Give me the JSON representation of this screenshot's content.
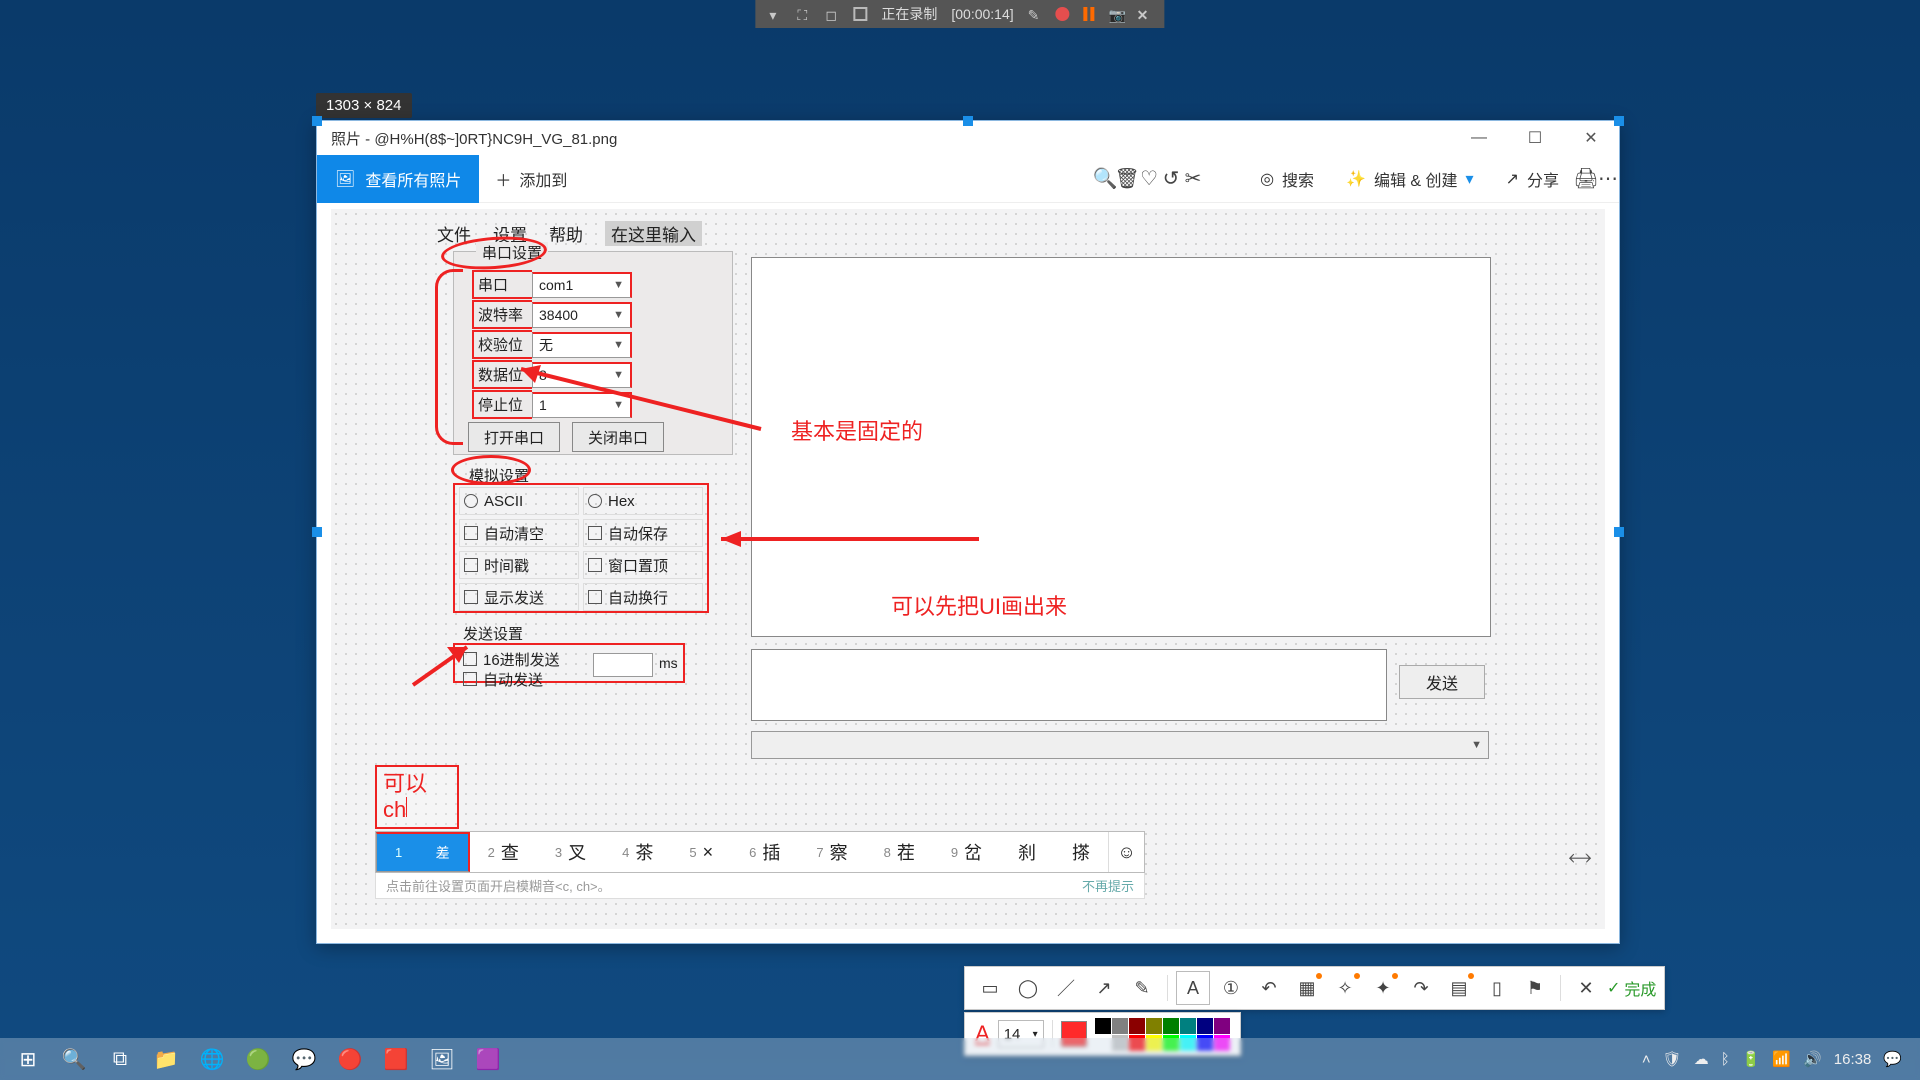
{
  "recorder": {
    "status": "正在录制",
    "time": "[00:00:14]"
  },
  "dim_badge": "1303 × 824",
  "window": {
    "title": "照片 - @H%H(8$~]0RT}NC9H_VG_81.png",
    "toolbar": {
      "view_all": "查看所有照片",
      "add_to": "添加到",
      "search": "搜索",
      "edit_create": "编辑 & 创建",
      "share": "分享"
    }
  },
  "menubar": {
    "file": "文件",
    "settings": "设置",
    "help": "帮助",
    "hint": "在这里输入"
  },
  "serial": {
    "group_title": "串口设置",
    "port_label": "串口",
    "port_value": "com1",
    "baud_label": "波特率",
    "baud_value": "38400",
    "parity_label": "校验位",
    "parity_value": "无",
    "data_label": "数据位",
    "data_value": "8",
    "stop_label": "停止位",
    "stop_value": "1",
    "open_btn": "打开串口",
    "close_btn": "关闭串口"
  },
  "recv": {
    "group_title": "模拟设置",
    "ascii": "ASCII",
    "hex": "Hex",
    "auto_clear": "自动清空",
    "auto_save": "自动保存",
    "timestamp": "时间戳",
    "topmost": "窗口置顶",
    "show_send": "显示发送",
    "auto_wrap": "自动换行"
  },
  "send": {
    "group_title": "发送设置",
    "hex_send": "16进制发送",
    "auto_send": "自动发送",
    "ms": "ms",
    "button": "发送"
  },
  "annotations": {
    "note1": "基本是固定的",
    "note2": "可以先把UI画出来",
    "float_l1": "可以",
    "float_l2": "ch"
  },
  "ime": {
    "candidates": [
      {
        "n": "1",
        "w": "差"
      },
      {
        "n": "2",
        "w": "查"
      },
      {
        "n": "3",
        "w": "叉"
      },
      {
        "n": "4",
        "w": "茶"
      },
      {
        "n": "5",
        "w": "×"
      },
      {
        "n": "6",
        "w": "插"
      },
      {
        "n": "7",
        "w": "察"
      },
      {
        "n": "8",
        "w": "茬"
      },
      {
        "n": "9",
        "w": "岔"
      }
    ],
    "extra1": "刹",
    "extra2": "搽",
    "hint_left": "点击前往设置页面开启模糊音<c, ch>。",
    "hint_right": "不再提示"
  },
  "annotool": {
    "done": "完成",
    "font_size": "14"
  },
  "palette": [
    "#000000",
    "#808080",
    "#8b0000",
    "#808000",
    "#008000",
    "#008080",
    "#000080",
    "#800080",
    "#ffffff",
    "#c0c0c0",
    "#ff0000",
    "#ffff00",
    "#00ff00",
    "#00ffff",
    "#0000ff",
    "#ff00ff"
  ],
  "taskbar": {
    "time": "16:38"
  }
}
